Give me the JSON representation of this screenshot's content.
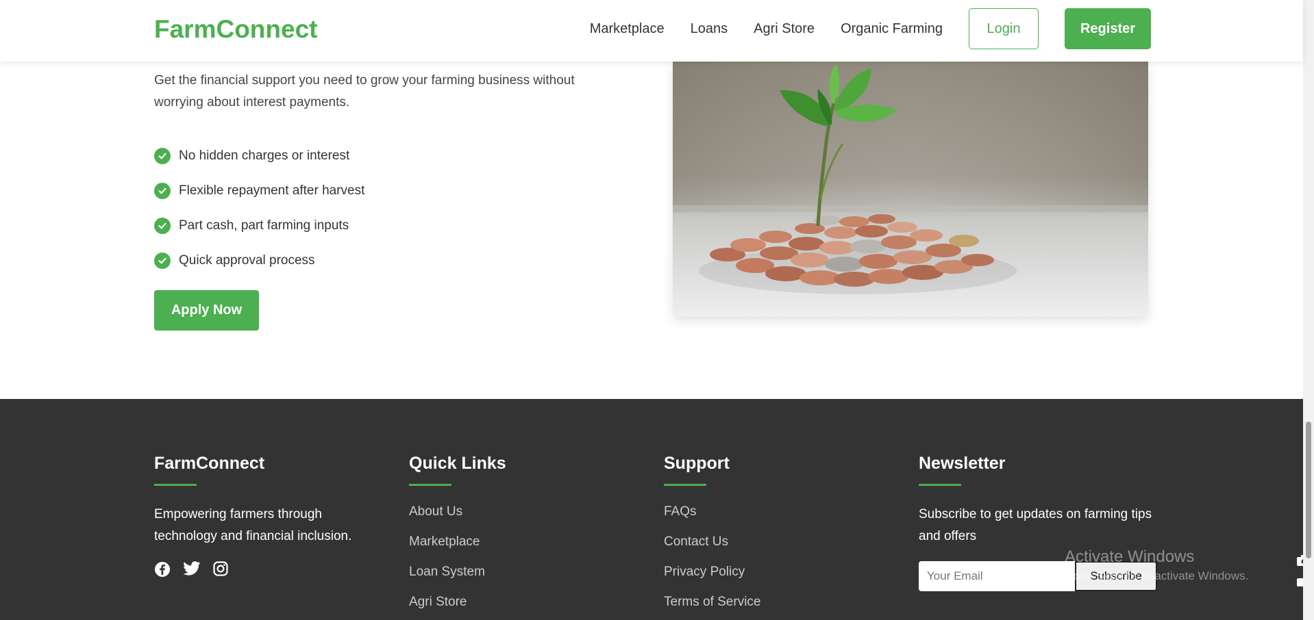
{
  "header": {
    "brand": "FarmConnect",
    "nav": [
      "Marketplace",
      "Loans",
      "Agri Store",
      "Organic Farming"
    ],
    "login": "Login",
    "register": "Register"
  },
  "loan_section": {
    "intro": "Get the financial support you need to grow your farming business without worrying about interest payments.",
    "features": [
      "No hidden charges or interest",
      "Flexible repayment after harvest",
      "Part cash, part farming inputs",
      "Quick approval process"
    ],
    "apply_label": "Apply Now"
  },
  "footer": {
    "about": {
      "title": "FarmConnect",
      "text": "Empowering farmers through technology and financial inclusion.",
      "socials": [
        "facebook-icon",
        "twitter-icon",
        "instagram-icon"
      ]
    },
    "quick_links": {
      "title": "Quick Links",
      "items": [
        "About Us",
        "Marketplace",
        "Loan System",
        "Agri Store"
      ]
    },
    "support": {
      "title": "Support",
      "items": [
        "FAQs",
        "Contact Us",
        "Privacy Policy",
        "Terms of Service"
      ]
    },
    "newsletter": {
      "title": "Newsletter",
      "text": "Subscribe to get updates on farming tips and offers",
      "placeholder": "Your Email",
      "button": "Subscribe"
    }
  },
  "watermark": {
    "title": "Activate Windows",
    "subtitle": "Go to Settings to activate Windows."
  },
  "colors": {
    "accent": "#4caf50",
    "footer_bg": "#333333"
  }
}
